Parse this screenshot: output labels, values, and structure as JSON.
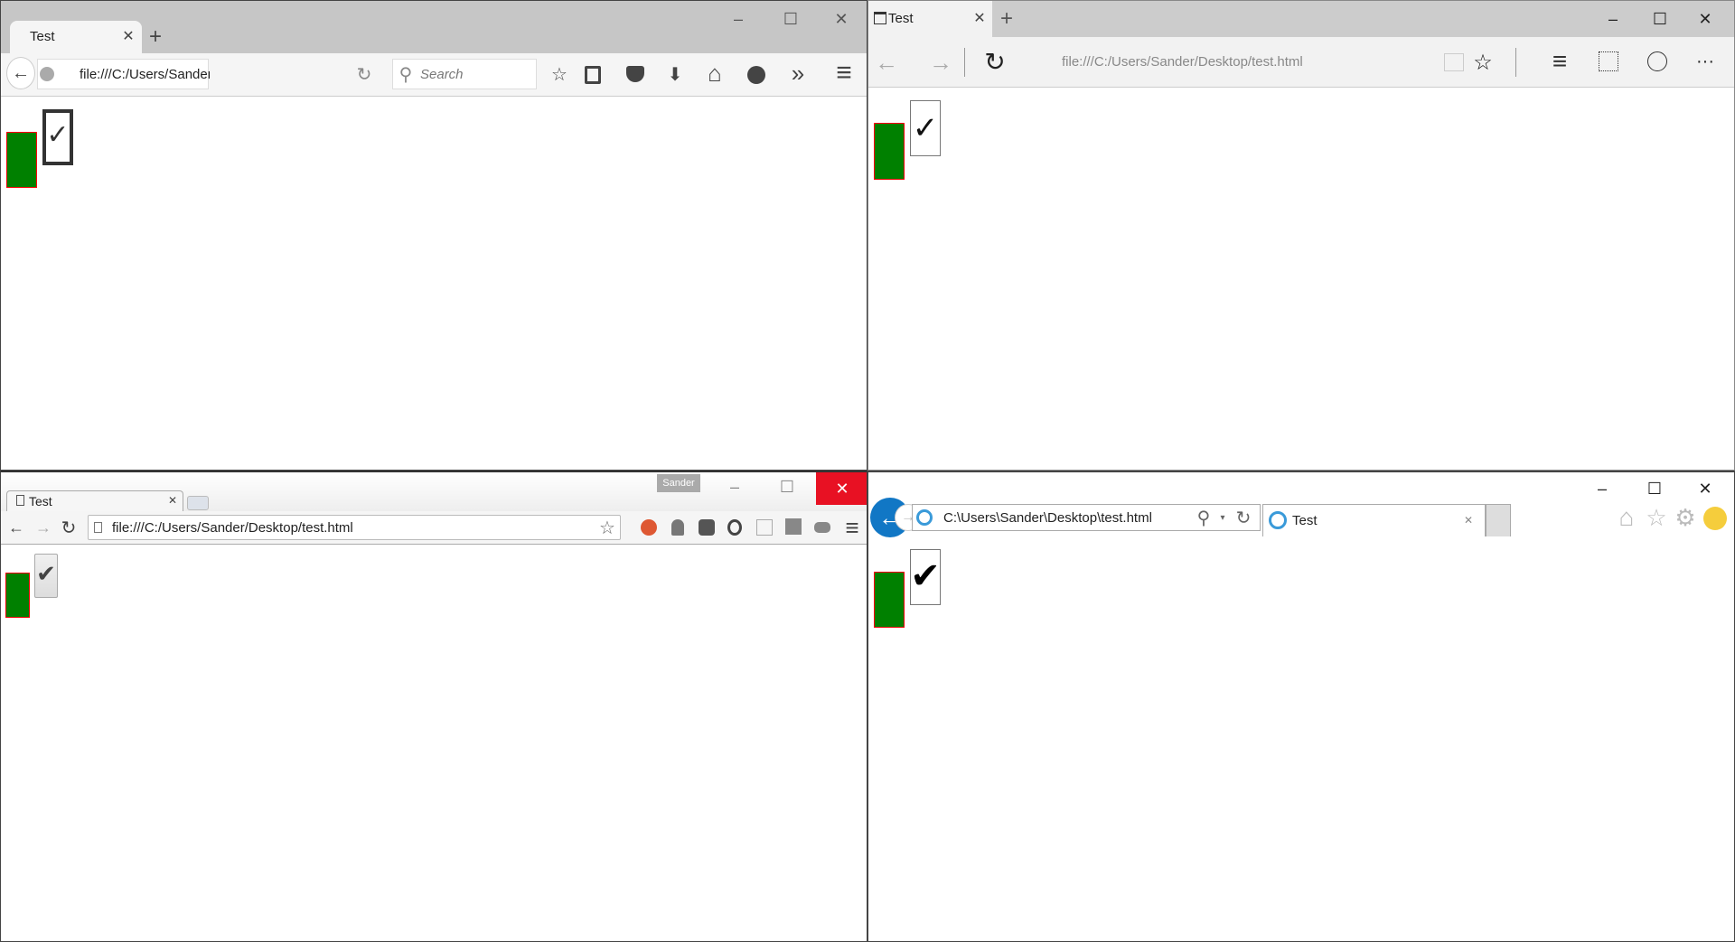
{
  "colors": {
    "box_fill": "#008000",
    "box_border": "#ff0000",
    "chrome_close": "#e81123",
    "ie_back": "#1177c5"
  },
  "firefox": {
    "tab_title": "Test",
    "url": "file:///C:/Users/Sander/Desktop/tes",
    "search_placeholder": "Search",
    "icons": [
      "back-icon",
      "globe-icon",
      "reload-icon",
      "search-icon",
      "star-icon",
      "reading-list-icon",
      "pocket-icon",
      "download-icon",
      "home-icon",
      "chat-icon",
      "overflow-icon",
      "menu-icon"
    ],
    "checkbox_checked": true
  },
  "edge": {
    "tab_title": "Test",
    "url": "file:///C:/Users/Sander/Desktop/test.html",
    "checkbox_checked": true
  },
  "chrome": {
    "tab_title": "Test",
    "profile": "Sander",
    "url": "file:///C:/Users/Sander/Desktop/test.html",
    "checkbox_checked": true
  },
  "ie": {
    "tab_title": "Test",
    "url": "C:\\Users\\Sander\\Desktop\\test.html",
    "checkbox_checked": true
  },
  "glyphs": {
    "close": "✕",
    "plus": "+",
    "min": "–",
    "max": "☐",
    "back": "←",
    "fwd": "→",
    "reload": "↻",
    "star": "☆",
    "more": "···",
    "chev": "»",
    "menu": "≡",
    "search": "⚲",
    "home": "⌂",
    "gear": "⚙",
    "smile": "☺",
    "check": "✔",
    "checklight": "✓",
    "down": "⬇",
    "doc": "🗋"
  }
}
